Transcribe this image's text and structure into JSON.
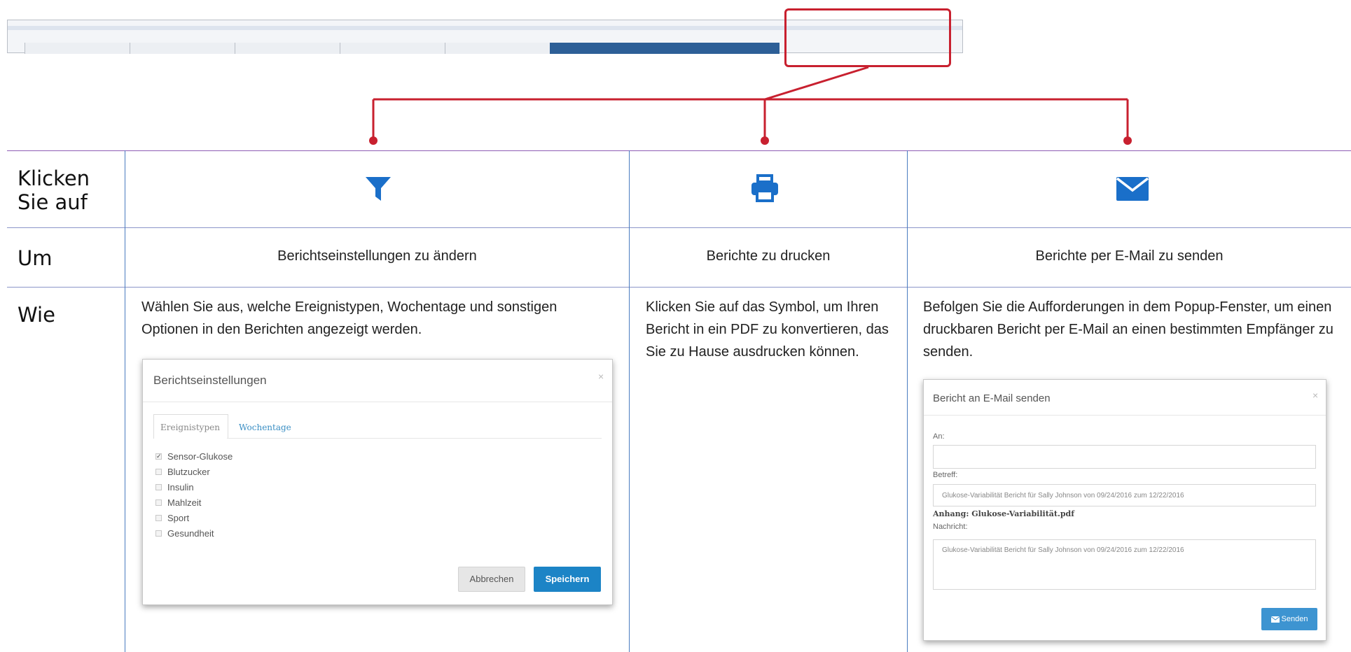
{
  "rows": {
    "click_label": "Klicken\nSie auf",
    "purpose_label": "Um",
    "how_label": "Wie"
  },
  "columns": [
    {
      "icon": "filter-icon",
      "purpose": "Berichtseinstellungen zu ändern",
      "how": "Wählen Sie aus, welche Ereignistypen, Wochentage und sonstigen Optionen in den Berichten angezeigt werden."
    },
    {
      "icon": "print-icon",
      "purpose": "Berichte zu drucken",
      "how": "Klicken Sie auf das Symbol, um Ihren Bericht in ein PDF zu konvertieren, das Sie zu Hause ausdrucken können."
    },
    {
      "icon": "envelope-icon",
      "purpose": "Berichte per E-Mail zu senden",
      "how": "Befolgen Sie die Aufforderungen in dem Popup-Fenster, um einen druckbaren Bericht per E-Mail an einen bestimmten Empfänger zu senden."
    }
  ],
  "settings_dialog": {
    "title": "Berichtseinstellungen",
    "close": "×",
    "tab_active": "Ereignistypen",
    "tab_other": "Wochentage",
    "options": [
      {
        "label": "Sensor-Glukose",
        "checked": true
      },
      {
        "label": "Blutzucker",
        "checked": false
      },
      {
        "label": "Insulin",
        "checked": false
      },
      {
        "label": "Mahlzeit",
        "checked": false
      },
      {
        "label": "Sport",
        "checked": false
      },
      {
        "label": "Gesundheit",
        "checked": false
      }
    ],
    "cancel_label": "Abbrechen",
    "save_label": "Speichern"
  },
  "email_dialog": {
    "title": "Bericht an E-Mail senden",
    "close": "×",
    "to_label": "An:",
    "to_value": "",
    "subject_label": "Betreff:",
    "subject_value": "Glukose-Variabilität Bericht für Sally Johnson von 09/24/2016 zum 12/22/2016",
    "attachment_label": "Anhang: Glukose-Variabilität.pdf",
    "message_label": "Nachricht:",
    "message_value": "Glukose-Variabilität Bericht für Sally Johnson von 09/24/2016 zum 12/22/2016",
    "send_label": "Senden"
  },
  "colors": {
    "accent_red": "#c8202f",
    "icon_blue": "#1a6fc9",
    "tab_active": "#2d5f97"
  }
}
